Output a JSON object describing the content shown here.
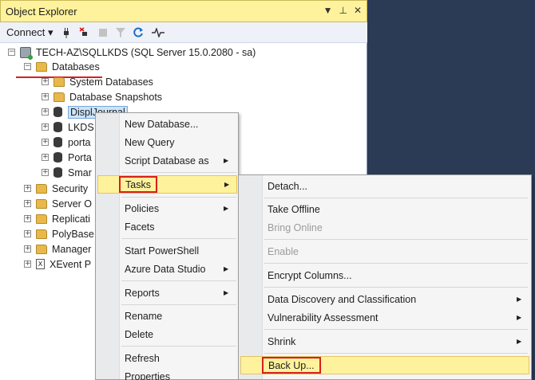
{
  "panel": {
    "title": "Object Explorer",
    "title_controls": [
      "▼",
      "⊥",
      "✕"
    ]
  },
  "toolbar": {
    "connect_label": "Connect ▾",
    "icons": [
      "connect-plug-icon",
      "disconnect-icon",
      "stop-icon",
      "filter-icon",
      "refresh-icon",
      "activity-monitor-icon"
    ]
  },
  "tree": {
    "server": "TECH-AZ\\SQLLKDS (SQL Server 15.0.2080 - sa)",
    "databases": "Databases",
    "system_databases": "System Databases",
    "database_snapshots": "Database Snapshots",
    "db_items": [
      "DisplJournal",
      "LKDS",
      "porta",
      "Porta",
      "Smar"
    ],
    "folders": [
      "Security",
      "Server O",
      "Replicati",
      "PolyBase",
      "Manager"
    ],
    "xevent": "XEvent P"
  },
  "context_menu": {
    "items": {
      "new_database": "New Database...",
      "new_query": "New Query",
      "script_database_as": "Script Database as",
      "tasks": "Tasks",
      "policies": "Policies",
      "facets": "Facets",
      "start_powershell": "Start PowerShell",
      "azure_data_studio": "Azure Data Studio",
      "reports": "Reports",
      "rename": "Rename",
      "delete": "Delete",
      "refresh": "Refresh",
      "properties": "Properties"
    }
  },
  "tasks_menu": {
    "items": {
      "detach": "Detach...",
      "take_offline": "Take Offline",
      "bring_online": "Bring Online",
      "enable": "Enable",
      "encrypt_columns": "Encrypt Columns...",
      "data_discovery": "Data Discovery and Classification",
      "vulnerability": "Vulnerability Assessment",
      "shrink": "Shrink",
      "back_up": "Back Up..."
    }
  },
  "colors": {
    "highlight": "#fff29d",
    "annotation_red": "#d81f1f",
    "background_dark": "#2b3a55"
  }
}
